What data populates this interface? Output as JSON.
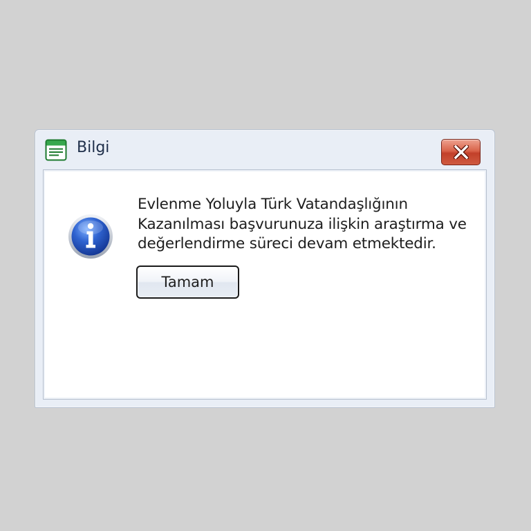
{
  "dialog": {
    "title": "Bilgi",
    "message": "Evlenme Yoluyla Türk Vatandaşlığının Kazanılması başvurunuza ilişkin araştırma ve değerlendirme süreci devam etmektedir.",
    "ok_label": "Tamam",
    "icons": {
      "app": "window-list-icon",
      "close": "close-x-icon",
      "info": "info-icon"
    },
    "colors": {
      "close_button": "#d05a42",
      "info_icon": "#2a5bc6",
      "title_text": "#1f2f4a"
    }
  }
}
